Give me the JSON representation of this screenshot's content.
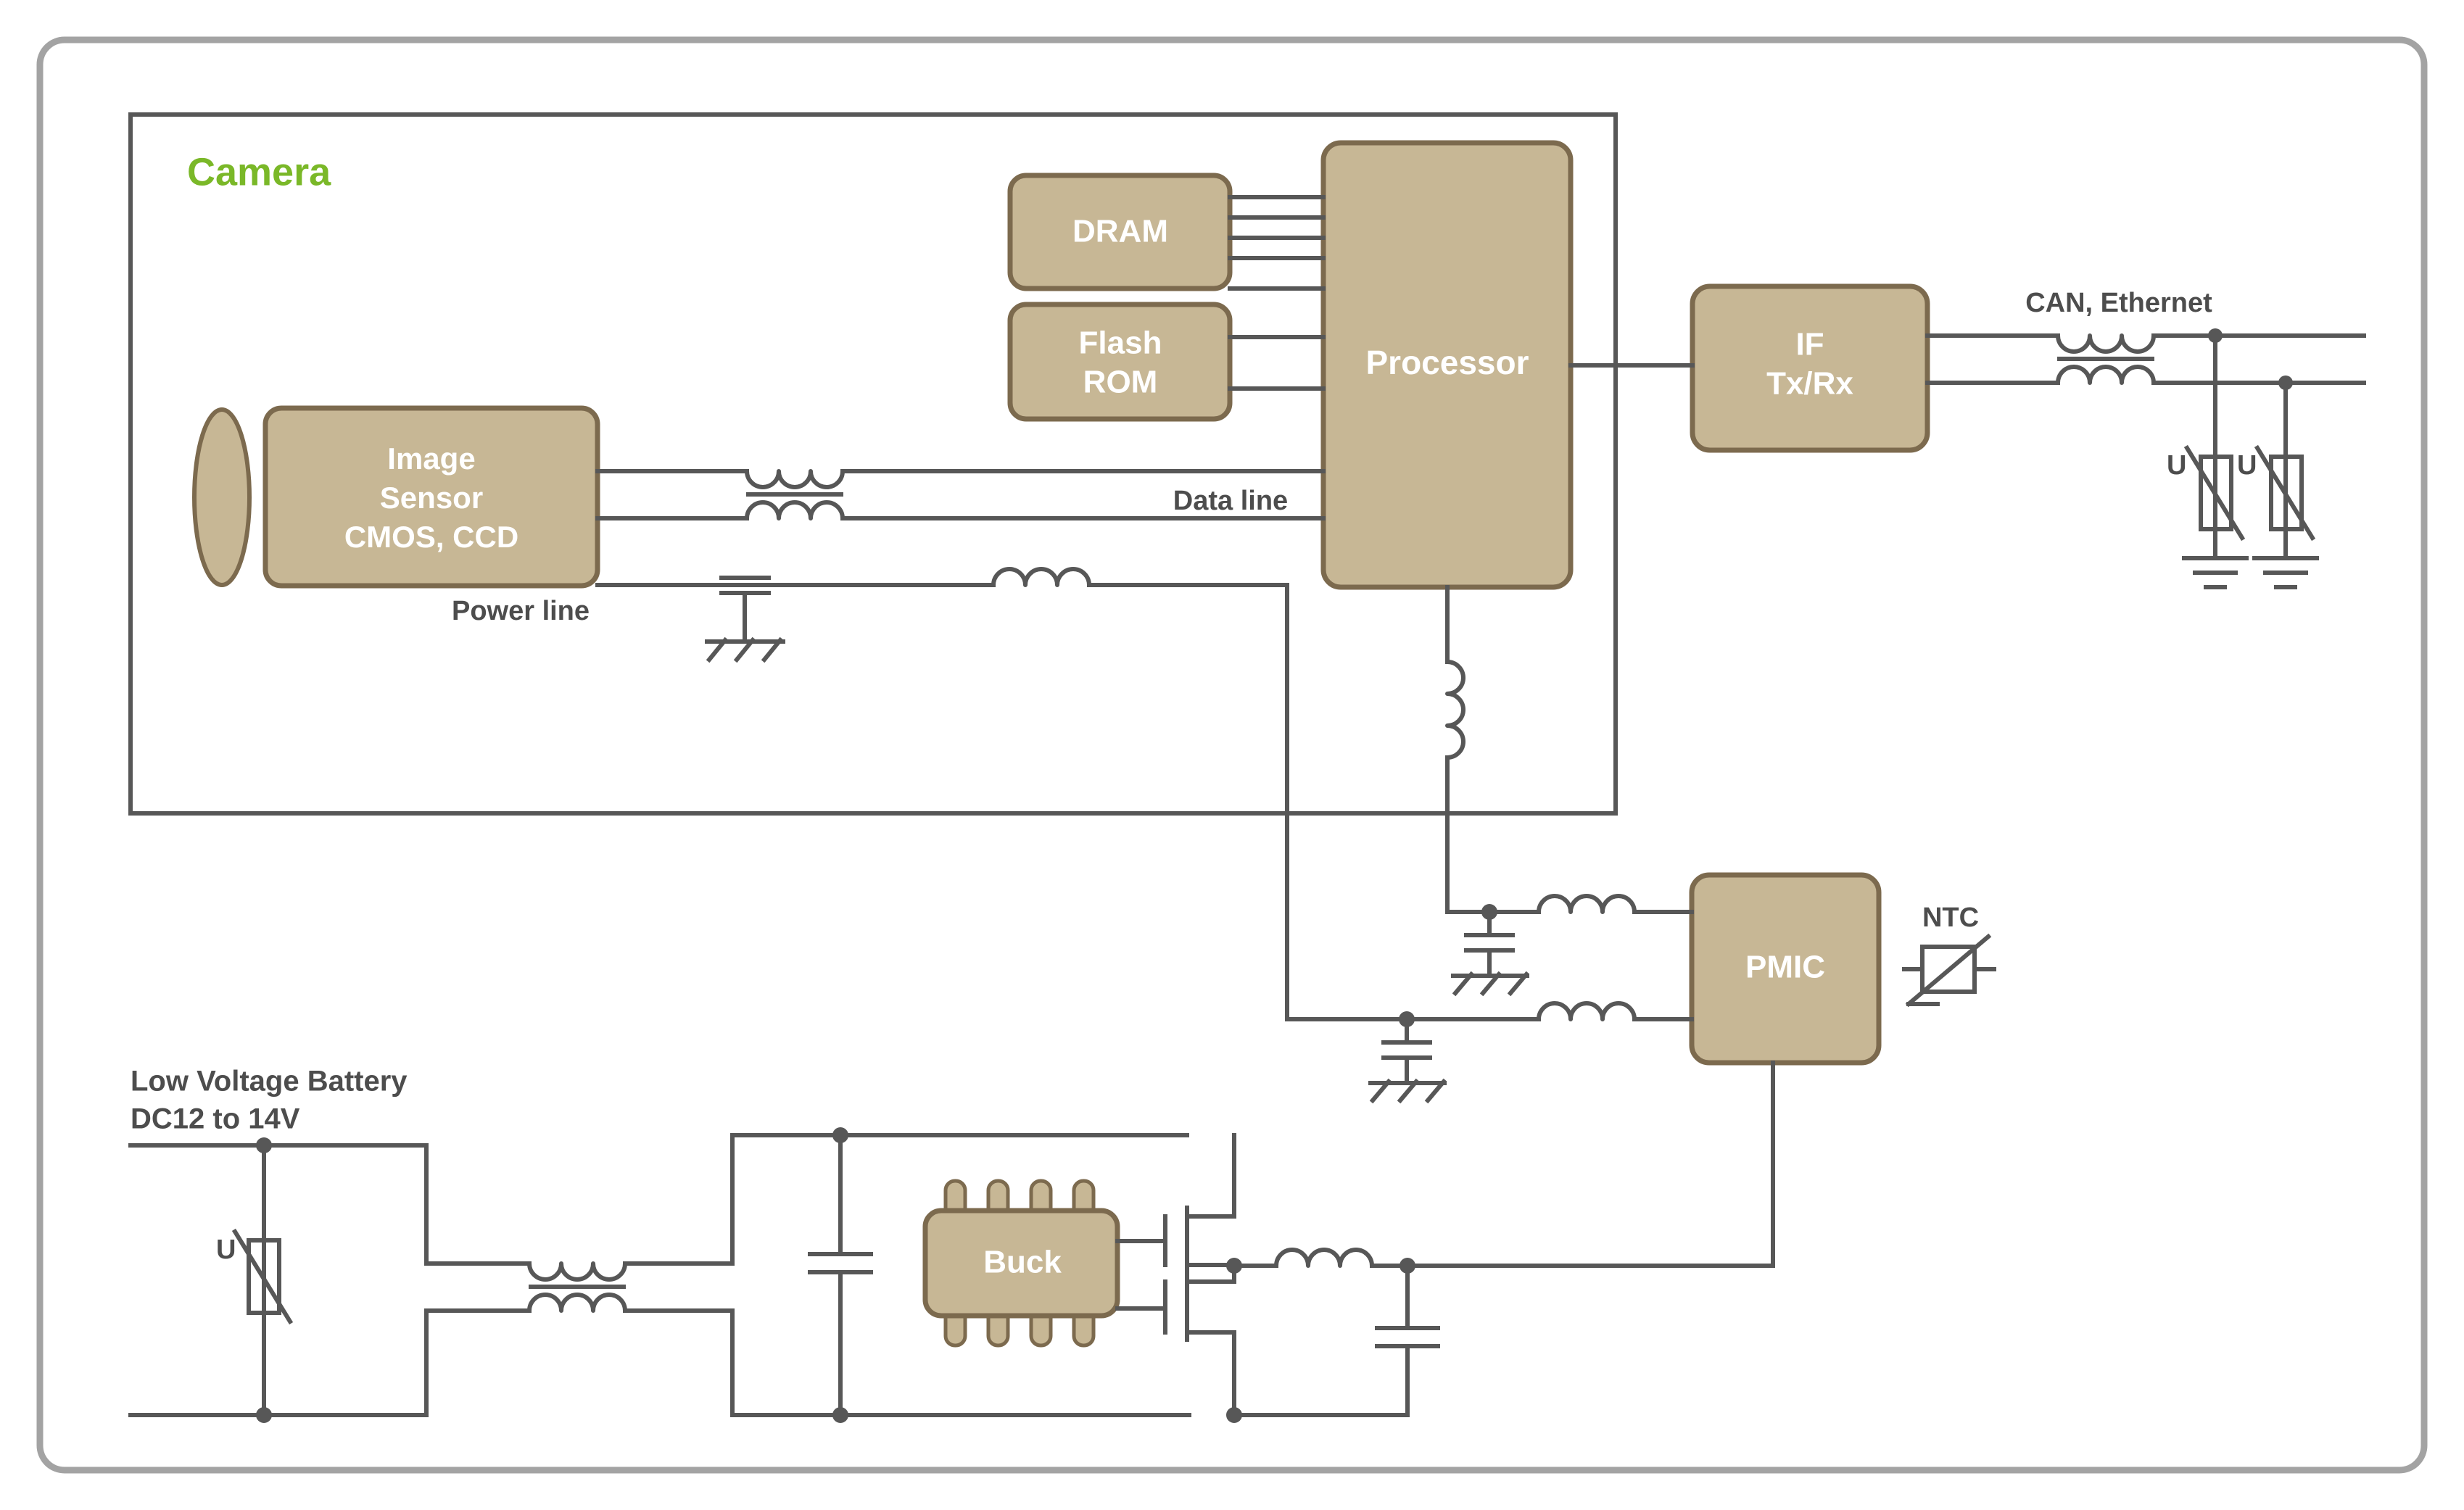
{
  "diagram": {
    "title_label": "Camera",
    "title_color": "#7ab828",
    "blocks": {
      "image_sensor": {
        "line1": "Image",
        "line2": "Sensor",
        "line3": "CMOS, CCD"
      },
      "dram": {
        "label": "DRAM"
      },
      "flash_rom": {
        "line1": "Flash",
        "line2": "ROM"
      },
      "processor": {
        "label": "Processor"
      },
      "if_txrx": {
        "line1": "IF",
        "line2": "Tx/Rx"
      },
      "pmic": {
        "label": "PMIC"
      },
      "buck": {
        "label": "Buck"
      }
    },
    "annotations": {
      "data_line": "Data line",
      "power_line": "Power line",
      "can_ethernet": "CAN, Ethernet",
      "ntc": "NTC",
      "battery_line1": "Low Voltage Battery",
      "battery_line2": "DC12 to 14V",
      "varistor_can_1": "U",
      "varistor_can_2": "U",
      "varistor_battery": "U"
    },
    "colors": {
      "block_fill": "#c7b795",
      "block_border": "#7c6a4e",
      "wire": "#575757",
      "frame_outer": "#a3a3a3",
      "frame_group": "#575757",
      "text_dark": "#4d4d4d",
      "text_light": "#ffffff",
      "accent_green": "#7ab828"
    }
  }
}
